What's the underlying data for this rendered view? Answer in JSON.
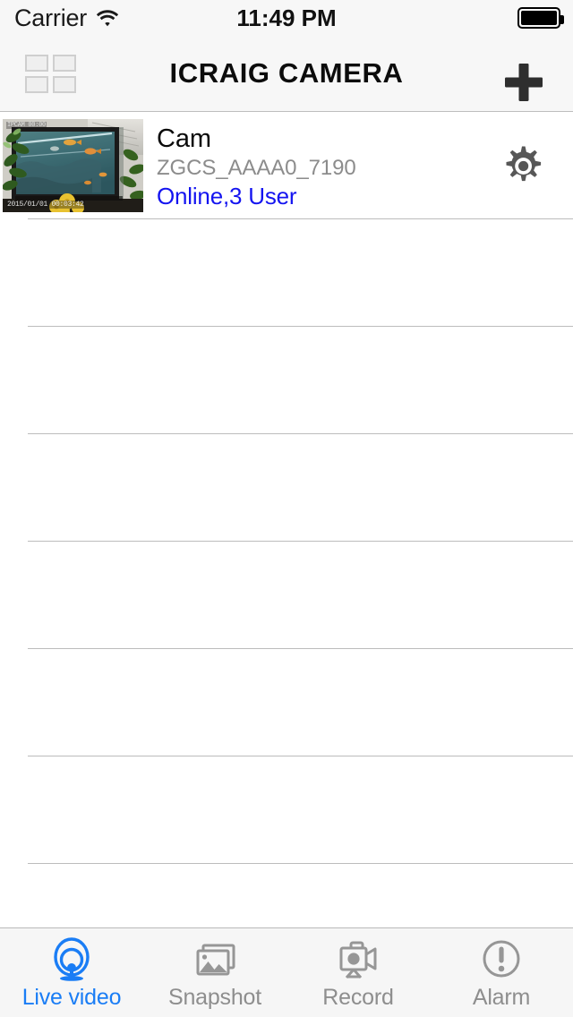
{
  "status_bar": {
    "carrier": "Carrier",
    "wifi_icon": "wifi-icon",
    "time": "11:49 PM",
    "battery_icon": "battery-full-icon"
  },
  "nav_bar": {
    "title": "ICRAIG CAMERA",
    "grid_icon": "grid-2x2-icon",
    "add_icon": "plus-icon"
  },
  "camera_list": {
    "items": [
      {
        "name": "Cam",
        "uid": "ZGCS_AAAA0_7190",
        "status": "Online,3 User",
        "status_color": "#1414f0",
        "settings_icon": "gear-icon",
        "thumbnail": {
          "scene": "aquarium-fish-tank",
          "overlay_top": "IPCAM  00:00",
          "overlay_bottom": "2015/01/01 00:03:42"
        }
      }
    ],
    "empty_row_count": 7
  },
  "tab_bar": {
    "active_index": 0,
    "active_color": "#1a7df5",
    "inactive_color": "#8e8e8e",
    "tabs": [
      {
        "label": "Live video",
        "icon": "live-video-camera-icon"
      },
      {
        "label": "Snapshot",
        "icon": "photo-stack-icon"
      },
      {
        "label": "Record",
        "icon": "video-camera-icon"
      },
      {
        "label": "Alarm",
        "icon": "exclamation-circle-icon"
      }
    ]
  }
}
